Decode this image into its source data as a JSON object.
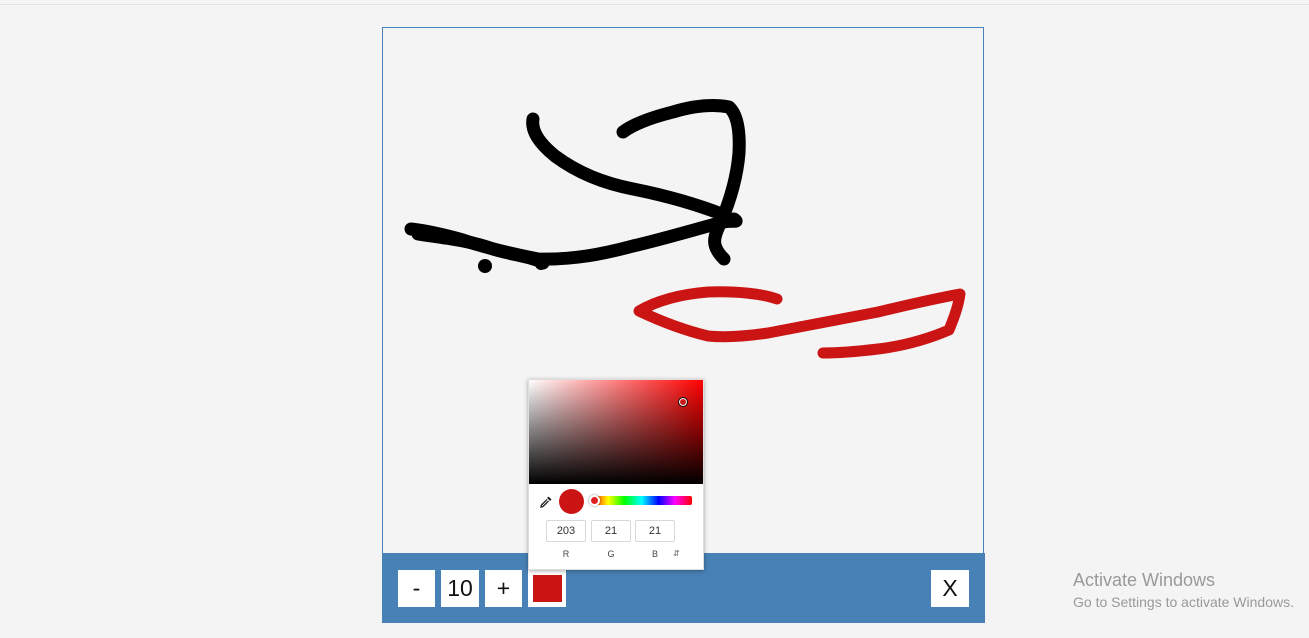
{
  "toolbar": {
    "minus_label": "-",
    "brush_size": "10",
    "plus_label": "+",
    "current_color": "#cb1515",
    "close_label": "X",
    "background_color": "#4881b5"
  },
  "canvas": {
    "background_color": "#f4f4f4",
    "border_color": "#4a7fbd",
    "stroke_colors": [
      "#000000",
      "#cb1515"
    ]
  },
  "color_picker": {
    "hue_color": "#ff0000",
    "preview_color": "#cb1515",
    "channels": {
      "r": {
        "label": "R",
        "value": "203"
      },
      "g": {
        "label": "G",
        "value": "21"
      },
      "b": {
        "label": "B",
        "value": "21"
      }
    },
    "mode_toggle_icon": "up-down-arrows-icon",
    "eyedropper_icon": "eyedropper-icon"
  },
  "watermark": {
    "title": "Activate Windows",
    "subtitle": "Go to Settings to activate Windows."
  }
}
